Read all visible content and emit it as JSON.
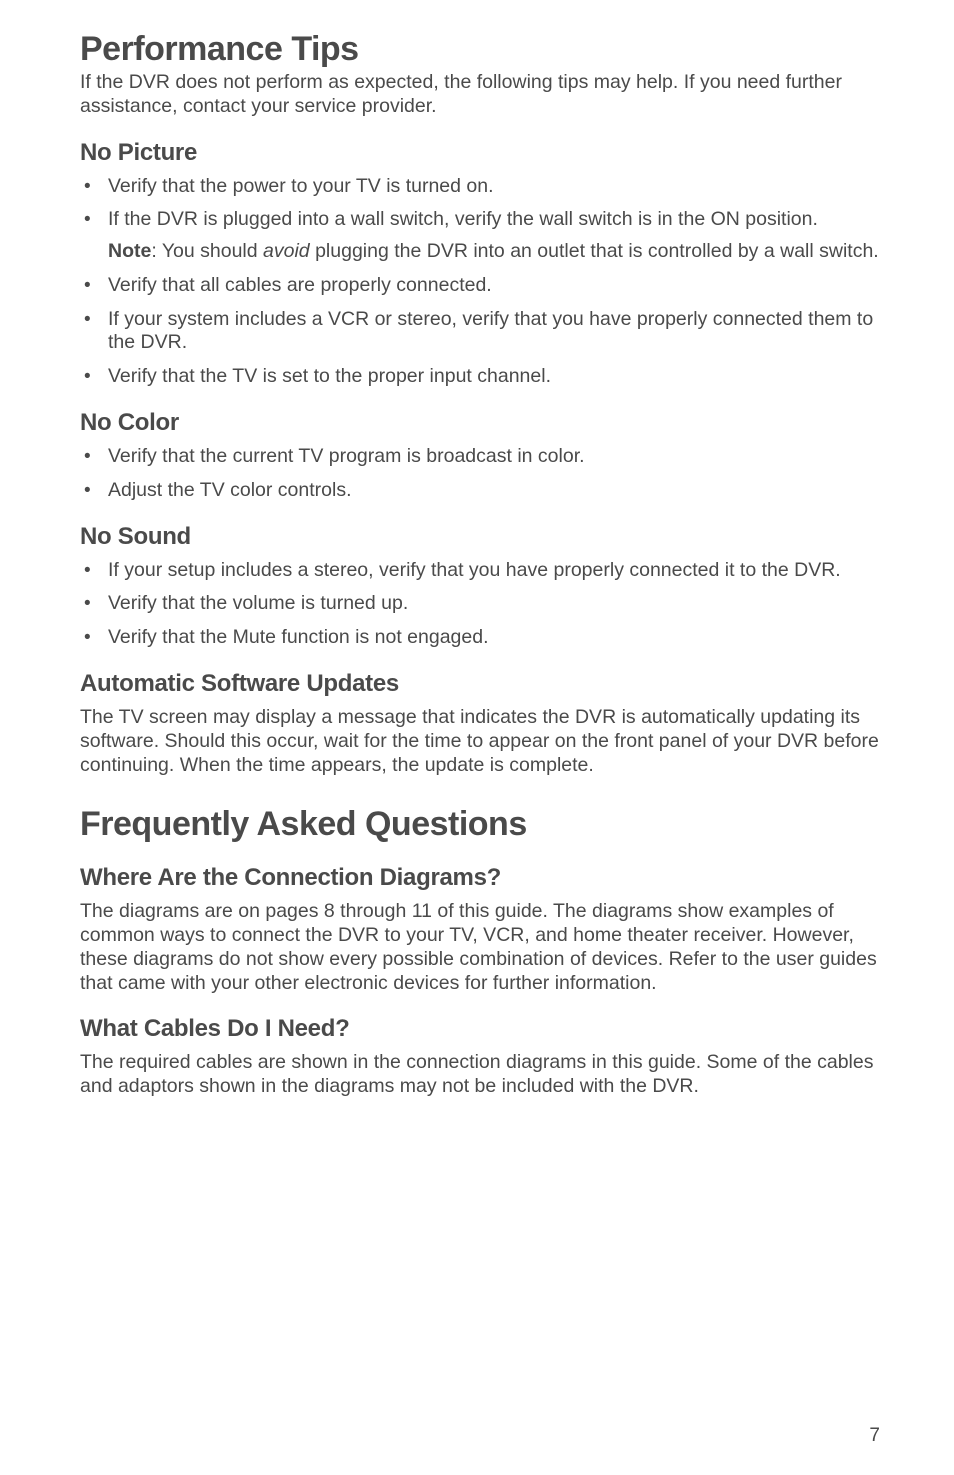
{
  "perf": {
    "title": "Performance Tips",
    "intro": "If the DVR does not perform as expected, the following tips may help. If you need further assistance, contact your service provider.",
    "noPicture": {
      "heading": "No Picture",
      "bullets": [
        "Verify that the power to your TV is turned on.",
        "If the DVR is plugged into a wall switch, verify the wall switch is in the ON position.",
        "Verify that all cables are properly connected.",
        "If your system includes a VCR or stereo, verify that you have properly connected them to the DVR.",
        "Verify that the TV is set to the proper input channel."
      ],
      "note": {
        "label": "Note",
        "colon": ": You should ",
        "italic": "avoid",
        "rest": " plugging the DVR into an outlet that is controlled by a wall switch."
      }
    },
    "noColor": {
      "heading": "No Color",
      "bullets": [
        "Verify that the current TV program is broadcast in color.",
        "Adjust the TV color controls."
      ]
    },
    "noSound": {
      "heading": "No Sound",
      "bullets": [
        "If your setup includes a stereo, verify that you have properly connected it to the DVR.",
        "Verify that the volume is turned up.",
        "Verify that the Mute function is not engaged."
      ]
    },
    "autoUpdates": {
      "heading": "Automatic Software Updates",
      "para": "The TV screen may display a message that indicates the DVR is automatically updating its software. Should this occur, wait for the time to appear on the front panel of your DVR before continuing. When the time appears, the update is complete."
    }
  },
  "faq": {
    "title": "Frequently Asked Questions",
    "connDiagrams": {
      "heading": "Where Are the Connection Diagrams?",
      "para": "The diagrams are on pages 8 through 11 of this guide. The diagrams show examples of common ways to connect the DVR to your TV, VCR, and home theater receiver. However, these diagrams do not show every possible combination of devices. Refer to the user guides that came with your other electronic devices for further information."
    },
    "cables": {
      "heading": "What Cables Do I Need?",
      "para": "The required cables are shown in the connection diagrams in this guide. Some of the cables and adaptors shown in the diagrams may not be included with the DVR."
    }
  },
  "pageNumber": "7"
}
